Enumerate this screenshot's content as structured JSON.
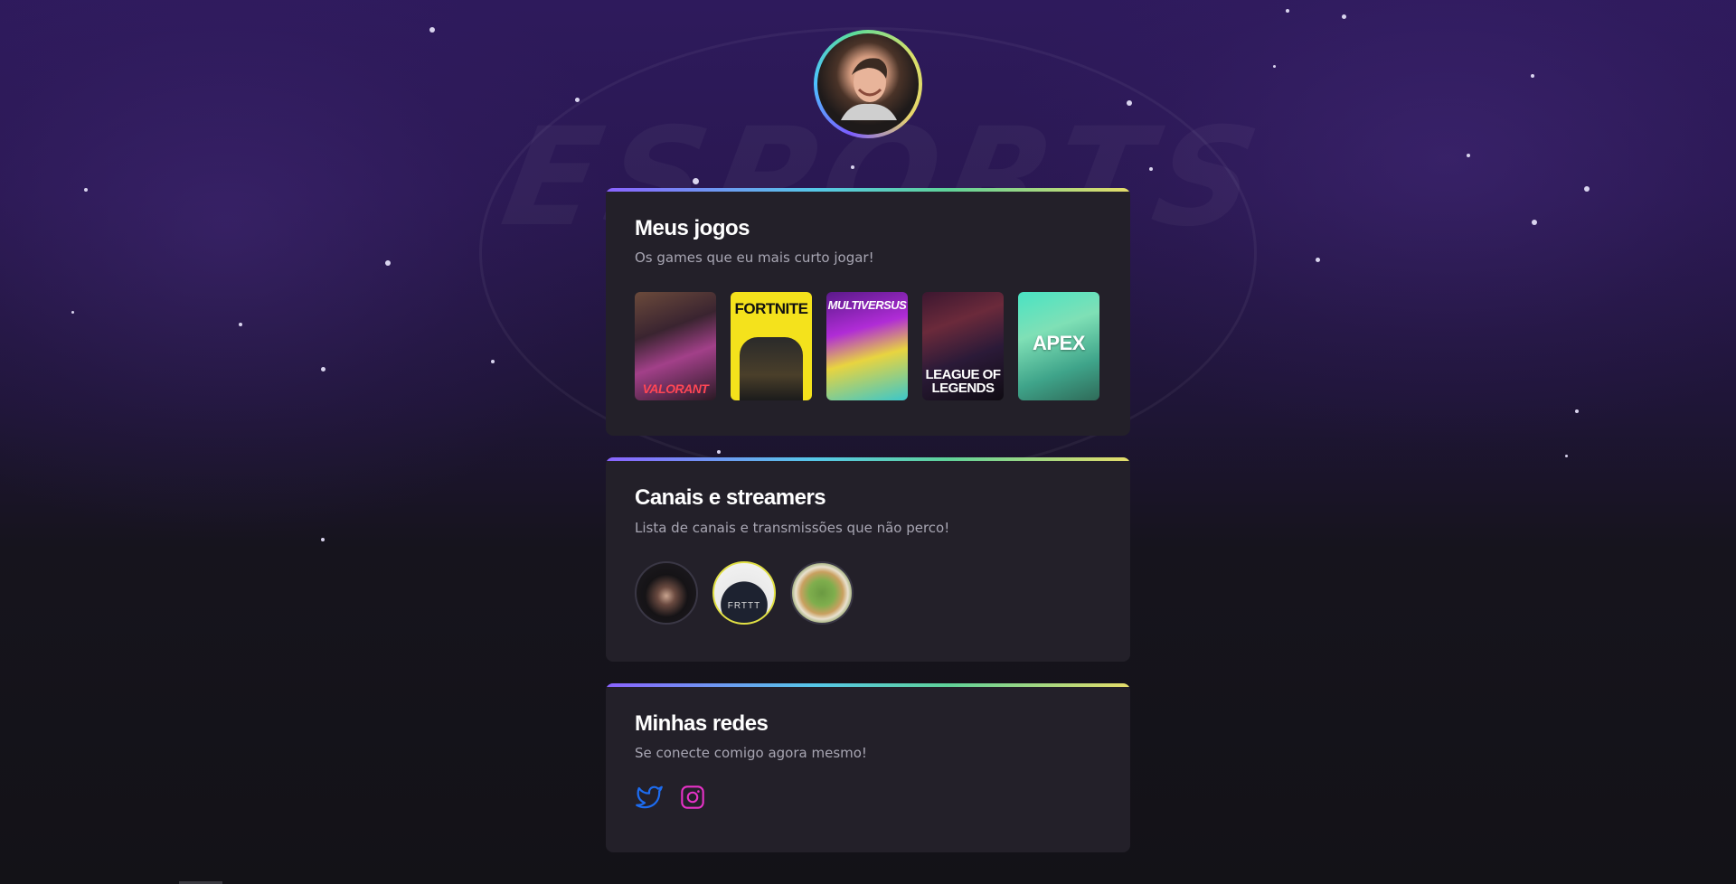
{
  "profile": {
    "avatar_icon": "person-avatar"
  },
  "games_section": {
    "title": "Meus jogos",
    "subtitle": "Os games que eu mais curto jogar!",
    "games": [
      {
        "label": "VALORANT"
      },
      {
        "label": "FORTNITE"
      },
      {
        "label": "MULTIVERSUS"
      },
      {
        "label": "LEAGUE OF LEGENDS"
      },
      {
        "label": "APEX"
      }
    ]
  },
  "channels_section": {
    "title": "Canais e streamers",
    "subtitle": "Lista de canais e transmissões que não perco!",
    "streamers": [
      {
        "label": ""
      },
      {
        "label": "FRTTT"
      },
      {
        "label": ""
      }
    ]
  },
  "social_section": {
    "title": "Minhas redes",
    "subtitle": "Se conecte comigo agora mesmo!",
    "links": [
      {
        "icon": "twitter-icon",
        "color": "#1d6cf0"
      },
      {
        "icon": "instagram-icon",
        "color": "#e832c8"
      }
    ]
  },
  "colors": {
    "card_background": "#232029",
    "accent_gradient": [
      "#8a63ff",
      "#56c8e8",
      "#5fd29a",
      "#e5dd6a"
    ],
    "subtitle_text": "#a8a6b3"
  }
}
